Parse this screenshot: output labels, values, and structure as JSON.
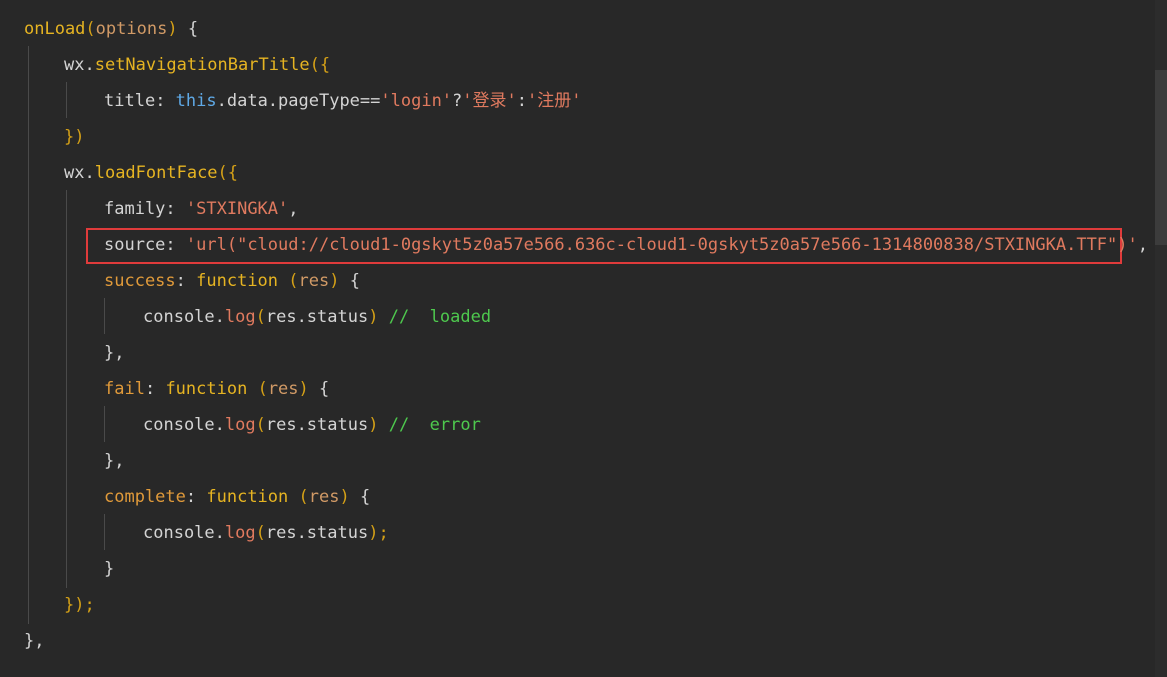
{
  "code": {
    "l1": {
      "name": "onLoad",
      "open": "(",
      "param": "options",
      "close": ")",
      "brace": " {"
    },
    "l2": {
      "obj": "wx.",
      "method": "setNavigationBarTitle",
      "open": "({"
    },
    "l3": {
      "key": "title",
      "colon": ": ",
      "this": "this",
      "expr": ".data.pageType==",
      "s1": "'login'",
      "q": "?",
      "s2": "'登录'",
      "c": ":",
      "s3": "'注册'"
    },
    "l4": {
      "text": "})"
    },
    "l5": {
      "obj": "wx.",
      "method": "loadFontFace",
      "open": "({"
    },
    "l6": {
      "key": "family",
      "colon": ": ",
      "str": "'STXINGKA'",
      "comma": ","
    },
    "l7": {
      "key": "source",
      "colon": ": ",
      "str": "'url(\"cloud://cloud1-0gskyt5z0a57e566.636c-cloud1-0gskyt5z0a57e566-1314800838/STXINGKA.TTF\")'",
      "comma": ","
    },
    "l8": {
      "key": "success",
      "colon": ": ",
      "kw": "function",
      "open": " (",
      "param": "res",
      "close": ")",
      "brace": " {"
    },
    "l9": {
      "obj": "console.",
      "method": "log",
      "open": "(",
      "arg": "res.status",
      "close": ")",
      "comment": " //  loaded"
    },
    "l10": {
      "text": "},"
    },
    "l11": {
      "key": "fail",
      "colon": ": ",
      "kw": "function",
      "open": " (",
      "param": "res",
      "close": ")",
      "brace": " {"
    },
    "l12": {
      "obj": "console.",
      "method": "log",
      "open": "(",
      "arg": "res.status",
      "close": ")",
      "comment": " //  error"
    },
    "l13": {
      "text": "},"
    },
    "l14": {
      "key": "complete",
      "colon": ": ",
      "kw": "function",
      "open": " (",
      "param": "res",
      "close": ")",
      "brace": " {"
    },
    "l15": {
      "obj": "console.",
      "method": "log",
      "open": "(",
      "arg": "res.status",
      "close": ");"
    },
    "l16": {
      "text": "}"
    },
    "l17": {
      "text": "});"
    },
    "l18": {
      "text": "},"
    }
  },
  "colors": {
    "background": "#282828",
    "highlight_border": "#e03b3b",
    "function": "#e6b422",
    "string": "#e07a5f",
    "this": "#5fa9e6",
    "comment": "#4ec94e"
  }
}
